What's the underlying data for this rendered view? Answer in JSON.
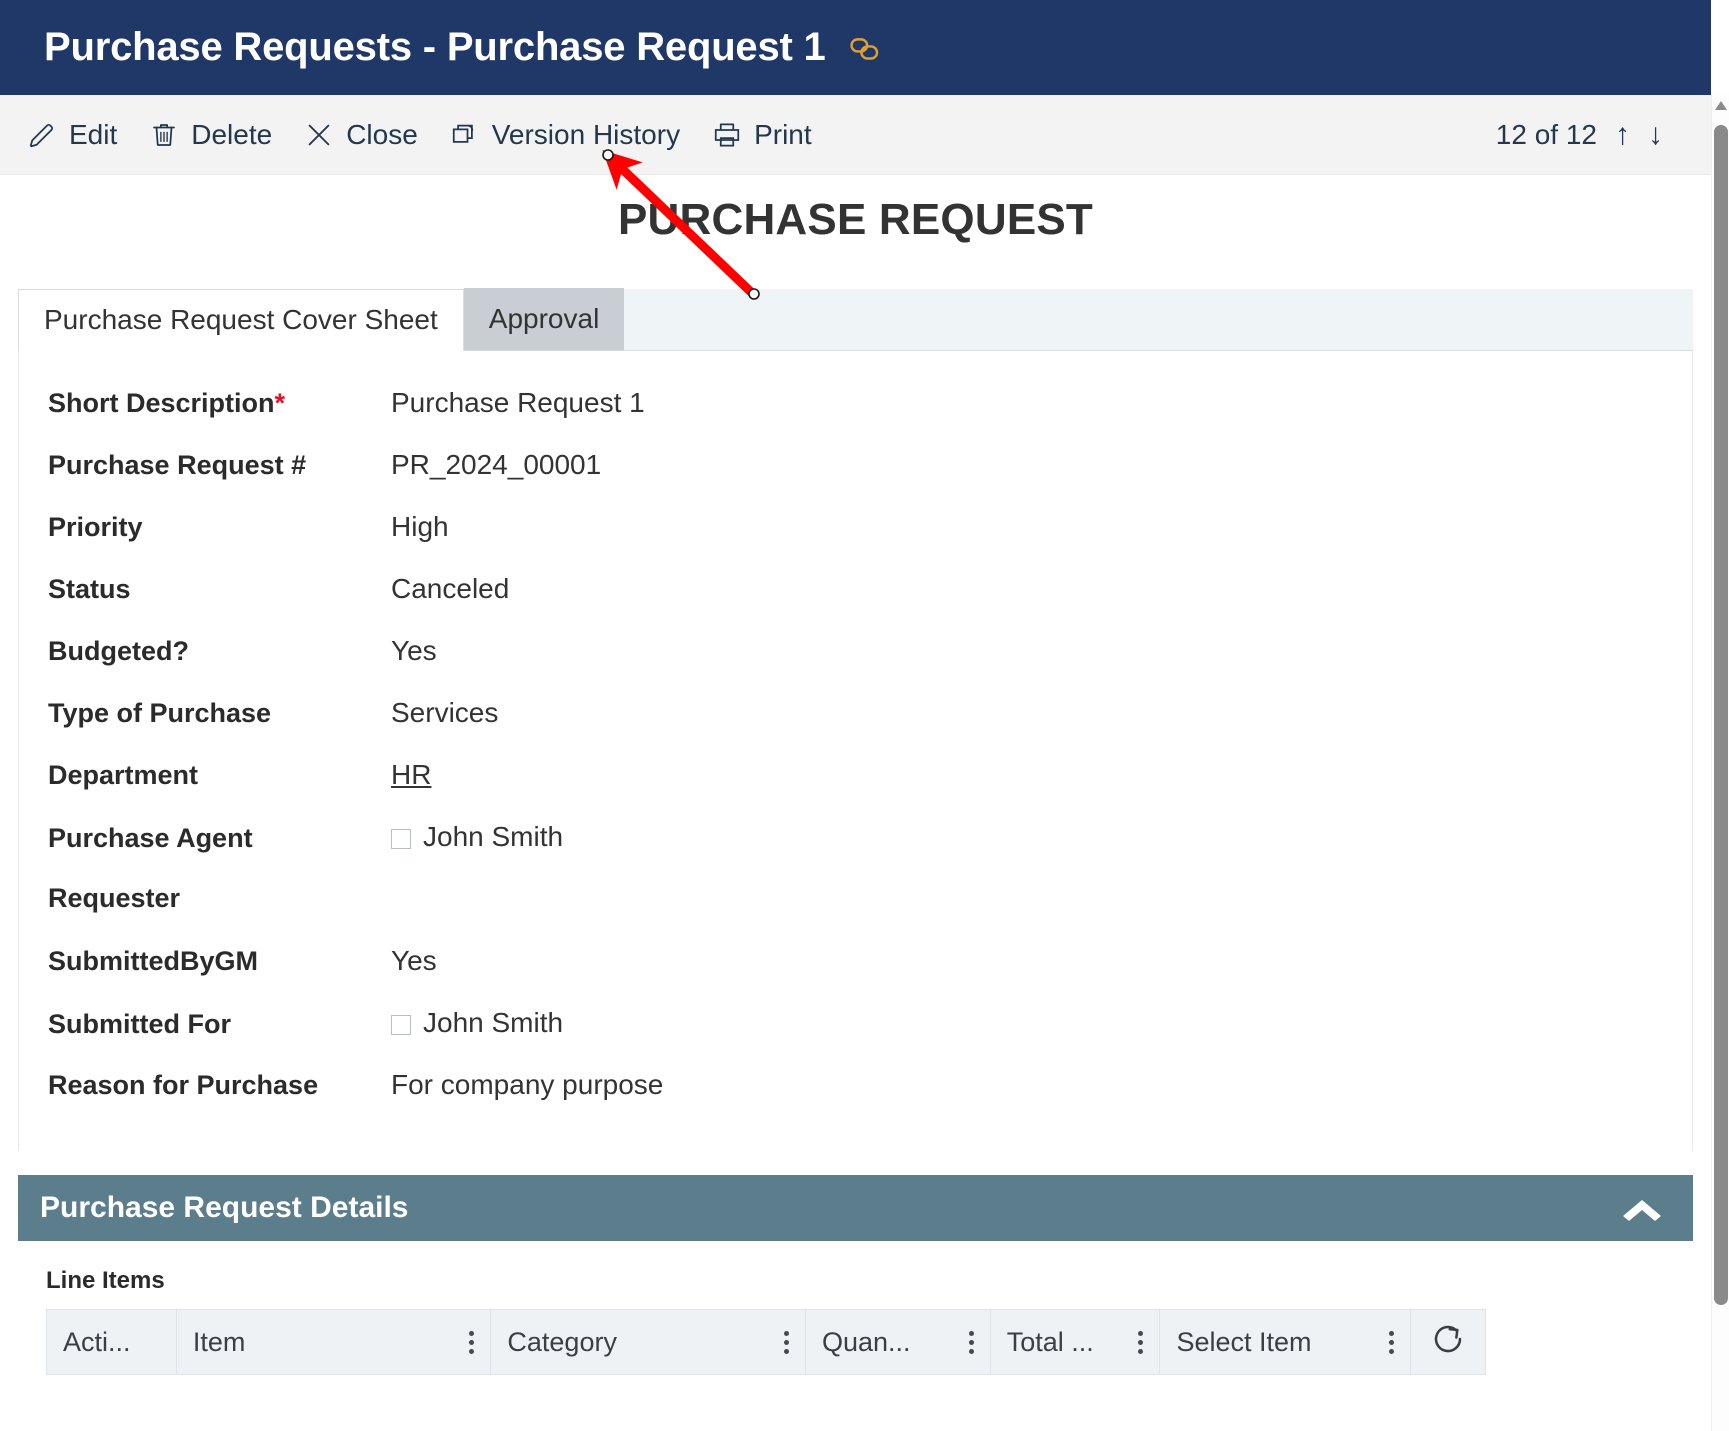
{
  "titlebar": {
    "title": "Purchase Requests - Purchase Request 1",
    "link_icon": "link-icon",
    "background": "#1f3868",
    "link_icon_color": "#e0a030"
  },
  "commandbar": {
    "buttons": [
      {
        "label": "Edit",
        "icon": "pencil-icon"
      },
      {
        "label": "Delete",
        "icon": "trash-icon"
      },
      {
        "label": "Close",
        "icon": "close-x-icon"
      },
      {
        "label": "Version History",
        "icon": "version-history-icon"
      },
      {
        "label": "Print",
        "icon": "printer-icon"
      }
    ],
    "pager": {
      "text": "12 of 12",
      "current": 12,
      "total": 12,
      "prev_icon": "arrow-up-icon",
      "next_icon": "arrow-down-icon"
    }
  },
  "document": {
    "heading": "PURCHASE REQUEST"
  },
  "tabs": [
    {
      "label": "Purchase Request Cover Sheet",
      "active": true
    },
    {
      "label": "Approval",
      "active": false
    }
  ],
  "form": {
    "fields": [
      {
        "label": "Short Description",
        "required": true,
        "value": "Purchase Request 1",
        "kind": "text"
      },
      {
        "label": "Purchase Request #",
        "required": false,
        "value": "PR_2024_00001",
        "kind": "text"
      },
      {
        "label": "Priority",
        "required": false,
        "value": "High",
        "kind": "text"
      },
      {
        "label": "Status",
        "required": false,
        "value": "Canceled",
        "kind": "text"
      },
      {
        "label": "Budgeted?",
        "required": false,
        "value": "Yes",
        "kind": "text"
      },
      {
        "label": "Type of Purchase",
        "required": false,
        "value": "Services",
        "kind": "text"
      },
      {
        "label": "Department",
        "required": false,
        "value": "HR",
        "kind": "link"
      },
      {
        "label": "Purchase Agent",
        "required": false,
        "value": "John Smith",
        "kind": "person"
      },
      {
        "label": "Requester",
        "required": false,
        "value": "",
        "kind": "empty"
      },
      {
        "label": "SubmittedByGM",
        "required": false,
        "value": "Yes",
        "kind": "text"
      },
      {
        "label": "Submitted For",
        "required": false,
        "value": "John Smith",
        "kind": "person"
      },
      {
        "label": "Reason for Purchase",
        "required": false,
        "value": "For company purpose",
        "kind": "text"
      }
    ]
  },
  "details_section": {
    "title": "Purchase Request Details",
    "background": "#5b7d8c",
    "toggle_icon": "chevron-up-icon",
    "expanded": true
  },
  "line_items": {
    "caption": "Line Items",
    "columns": [
      {
        "label": "Acti...",
        "menu": false
      },
      {
        "label": "Item",
        "menu": true
      },
      {
        "label": "Category",
        "menu": true
      },
      {
        "label": "Quan...",
        "menu": true
      },
      {
        "label": "Total ...",
        "menu": true
      },
      {
        "label": "Select Item",
        "menu": true
      }
    ],
    "refresh_icon": "refresh-icon",
    "rows": []
  },
  "scrollbar": {
    "up_icon": "scroll-up-arrow-icon",
    "thumb": "scroll-thumb"
  },
  "annotation": {
    "arrow_color": "#ff0000",
    "arrow_head_target": "version-history-button"
  }
}
